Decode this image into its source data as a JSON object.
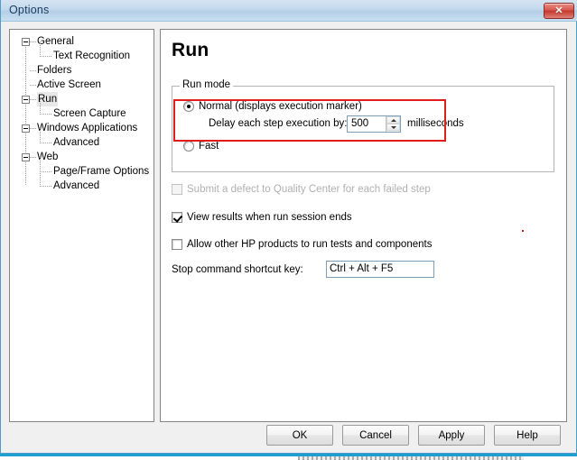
{
  "window": {
    "title": "Options",
    "close_icon": "close-icon",
    "close_glyph": "✕"
  },
  "theme": {
    "titlebar_start": "#d5e4f2",
    "titlebar_end": "#c9dff0",
    "close_button": "#c33a2f",
    "highlight_border": "#e21b1b",
    "panel_border": "#848484",
    "dialog_face": "#f0f0f0"
  },
  "tree": {
    "nodes": [
      {
        "label": "General",
        "level": 0,
        "expander": "minus",
        "selected": false
      },
      {
        "label": "Text Recognition",
        "level": 1,
        "expander": "none",
        "selected": false
      },
      {
        "label": "Folders",
        "level": 0,
        "expander": "none",
        "selected": false
      },
      {
        "label": "Active Screen",
        "level": 0,
        "expander": "none",
        "selected": false
      },
      {
        "label": "Run",
        "level": 0,
        "expander": "minus",
        "selected": true
      },
      {
        "label": "Screen Capture",
        "level": 1,
        "expander": "none",
        "selected": false
      },
      {
        "label": "Windows Applications",
        "level": 0,
        "expander": "minus",
        "selected": false
      },
      {
        "label": "Advanced",
        "level": 1,
        "expander": "none",
        "selected": false
      },
      {
        "label": "Web",
        "level": 0,
        "expander": "minus",
        "selected": false
      },
      {
        "label": "Page/Frame Options",
        "level": 1,
        "expander": "none",
        "selected": false
      },
      {
        "label": "Advanced",
        "level": 1,
        "expander": "none",
        "selected": false
      }
    ]
  },
  "page": {
    "title": "Run",
    "run_mode": {
      "legend": "Run mode",
      "normal": {
        "label": "Normal (displays execution marker)",
        "selected": true
      },
      "fast": {
        "label": "Fast",
        "selected": false
      },
      "delay": {
        "label": "Delay each step execution by:",
        "value": "500",
        "units": "milliseconds",
        "spin_up_icon": "chevron-up-icon",
        "spin_down_icon": "chevron-down-icon"
      }
    },
    "checkboxes": [
      {
        "label": "Submit a defect to Quality Center for each failed step",
        "checked": false,
        "disabled": true
      },
      {
        "label": "View results when run session ends",
        "checked": true,
        "disabled": false
      },
      {
        "label": "Allow other HP products to run tests and components",
        "checked": false,
        "disabled": false
      }
    ],
    "shortcut": {
      "label": "Stop command shortcut key:",
      "value": "Ctrl + Alt + F5"
    }
  },
  "buttons": [
    {
      "label": "OK"
    },
    {
      "label": "Cancel"
    },
    {
      "label": "Apply"
    },
    {
      "label": "Help"
    }
  ]
}
